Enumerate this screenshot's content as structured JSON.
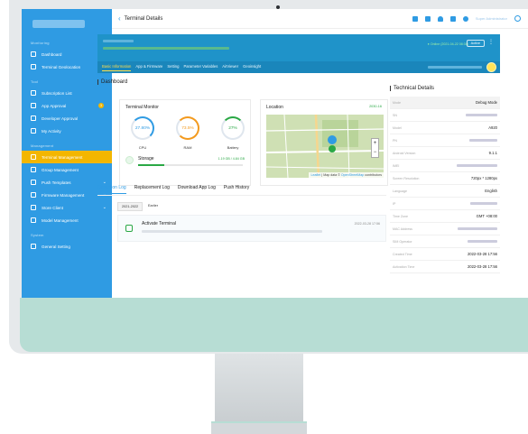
{
  "topbar": {
    "back_icon": "chevron-left-icon",
    "title": "Terminal Details",
    "user": "Super Administrator"
  },
  "sidebar": {
    "sections": [
      "Monitoring",
      "Tool",
      "Management",
      "System"
    ],
    "items": [
      {
        "label": "Dashboard",
        "icon": "dashboard-icon",
        "chevron": "⌄"
      },
      {
        "label": "Terminal Geolocation",
        "icon": "pin-icon"
      },
      {
        "label": "Subscription List",
        "icon": "list-icon"
      },
      {
        "label": "App Approval",
        "icon": "grid-icon",
        "badge": "3"
      },
      {
        "label": "Developer Approval",
        "icon": "user-icon"
      },
      {
        "label": "My Activity",
        "icon": "calendar-icon"
      },
      {
        "label": "Terminal Management",
        "icon": "terminal-icon"
      },
      {
        "label": "Group Management",
        "icon": "group-icon"
      },
      {
        "label": "Push Templates",
        "icon": "template-icon",
        "chevron": "⌄"
      },
      {
        "label": "Firmware Management",
        "icon": "firmware-icon",
        "chevron": "⌄"
      },
      {
        "label": "Store Client",
        "icon": "store-icon",
        "chevron": "⌄"
      },
      {
        "label": "Model Management",
        "icon": "model-icon"
      },
      {
        "label": "General Setting",
        "icon": "settings-icon"
      }
    ]
  },
  "terminal": {
    "online": "Online (2021-04-22 08:38)",
    "status_button": "Active",
    "tabs": [
      "Basic Information",
      "App & Firmware",
      "Setting",
      "Parameter Variables",
      "AirViewer",
      "Geoinsight"
    ]
  },
  "dashboard": {
    "title": "Dashboard",
    "monitor_title": "Terminal Monitor",
    "cpu": {
      "value": "27.80%",
      "label": "CPU",
      "color": "#2f9be3",
      "fraction": 0.278
    },
    "ram": {
      "value": "73.5%",
      "label": "RAM",
      "color": "#f39a1e",
      "fraction": 0.735
    },
    "battery": {
      "value": "27%",
      "label": "Battery",
      "color": "#2aa845",
      "fraction": 0.27
    },
    "storage": {
      "label": "Storage",
      "value": "1.19 GB / 4.84 GB",
      "fraction": 0.25
    },
    "location_title": "Location",
    "location_date": "2030-16",
    "map_attr_leaflet": "Leaflet",
    "map_attr_text": " | Map data © ",
    "map_attr_osm": "OpenStreetMap",
    "map_attr_tail": " contributors"
  },
  "tech": {
    "title": "Technical Details",
    "rows": [
      {
        "label": "Mode",
        "value": "Debug Mode"
      },
      {
        "label": "SN",
        "value": ""
      },
      {
        "label": "Model",
        "value": "A920"
      },
      {
        "label": "PN",
        "value": ""
      },
      {
        "label": "Android Version",
        "value": "9.1.1"
      },
      {
        "label": "IMEI",
        "value": ""
      },
      {
        "label": "Screen Resolution",
        "value": "720px * 1280px"
      },
      {
        "label": "Language",
        "value": "English"
      },
      {
        "label": "IP",
        "value": ""
      },
      {
        "label": "Time Zone",
        "value": "GMT +08:00"
      },
      {
        "label": "MAC Address",
        "value": ""
      },
      {
        "label": "SIM Operator",
        "value": ""
      },
      {
        "label": "Created Time",
        "value": "2022-03-28 17:56"
      },
      {
        "label": "Activation Time",
        "value": "2022-03-28 17:56"
      }
    ]
  },
  "logs": {
    "tabs": [
      "Operation Log",
      "Replacement Log",
      "Download App Log",
      "Push History"
    ],
    "years": [
      "2021-2022",
      "Earlier"
    ],
    "entry": {
      "title": "Activate Terminal",
      "date": "2022-03-28 17:56"
    }
  }
}
